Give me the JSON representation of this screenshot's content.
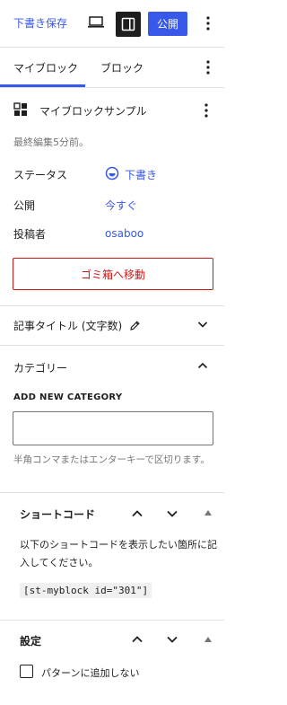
{
  "header": {
    "save_draft": "下書き保存",
    "publish": "公開"
  },
  "tabs": [
    {
      "label": "マイブロック"
    },
    {
      "label": "ブロック"
    }
  ],
  "block": {
    "name": "マイブロックサンプル",
    "last_edited": "最終編集5分前。"
  },
  "meta": {
    "status_label": "ステータス",
    "status_value": "下書き",
    "publish_label": "公開",
    "publish_value": "今すぐ",
    "author_label": "投稿者",
    "author_value": "osaboo"
  },
  "trash_label": "ゴミ箱へ移動",
  "panels": {
    "title_count": "記事タイトル (文字数)",
    "category": "カテゴリー",
    "add_new_category": "ADD NEW CATEGORY",
    "category_input_value": "",
    "category_help": "半角コンマまたはエンターキーで区切ります。"
  },
  "shortcode_box": {
    "title": "ショートコード",
    "description": "以下のショートコードを表示したい箇所に記入してください。",
    "code": "[st-myblock id=\"301\"]"
  },
  "settings_box": {
    "title": "設定",
    "checkbox_label": "パターンに追加しない",
    "checkbox_checked": false
  },
  "colors": {
    "accent": "#3858e9",
    "danger": "#cc1818",
    "text": "#1e1e1e",
    "muted": "#757575",
    "border": "#e0e0e0"
  }
}
